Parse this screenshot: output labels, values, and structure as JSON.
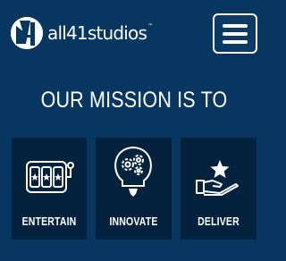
{
  "header": {
    "logo_text": "all41studios",
    "logo_tm": "™",
    "logo_icon": "all41-logo-mark",
    "menu_icon": "hamburger-icon"
  },
  "main": {
    "heading": "OUR MISSION IS TO",
    "cards": [
      {
        "label": "ENTERTAIN",
        "icon": "slot-machine-icon"
      },
      {
        "label": "INNOVATE",
        "icon": "gears-lightbulb-icon"
      },
      {
        "label": "DELIVER",
        "icon": "hand-star-icon"
      }
    ]
  },
  "colors": {
    "background": "#073661",
    "card": "#03223d",
    "text": "#ffffff"
  }
}
